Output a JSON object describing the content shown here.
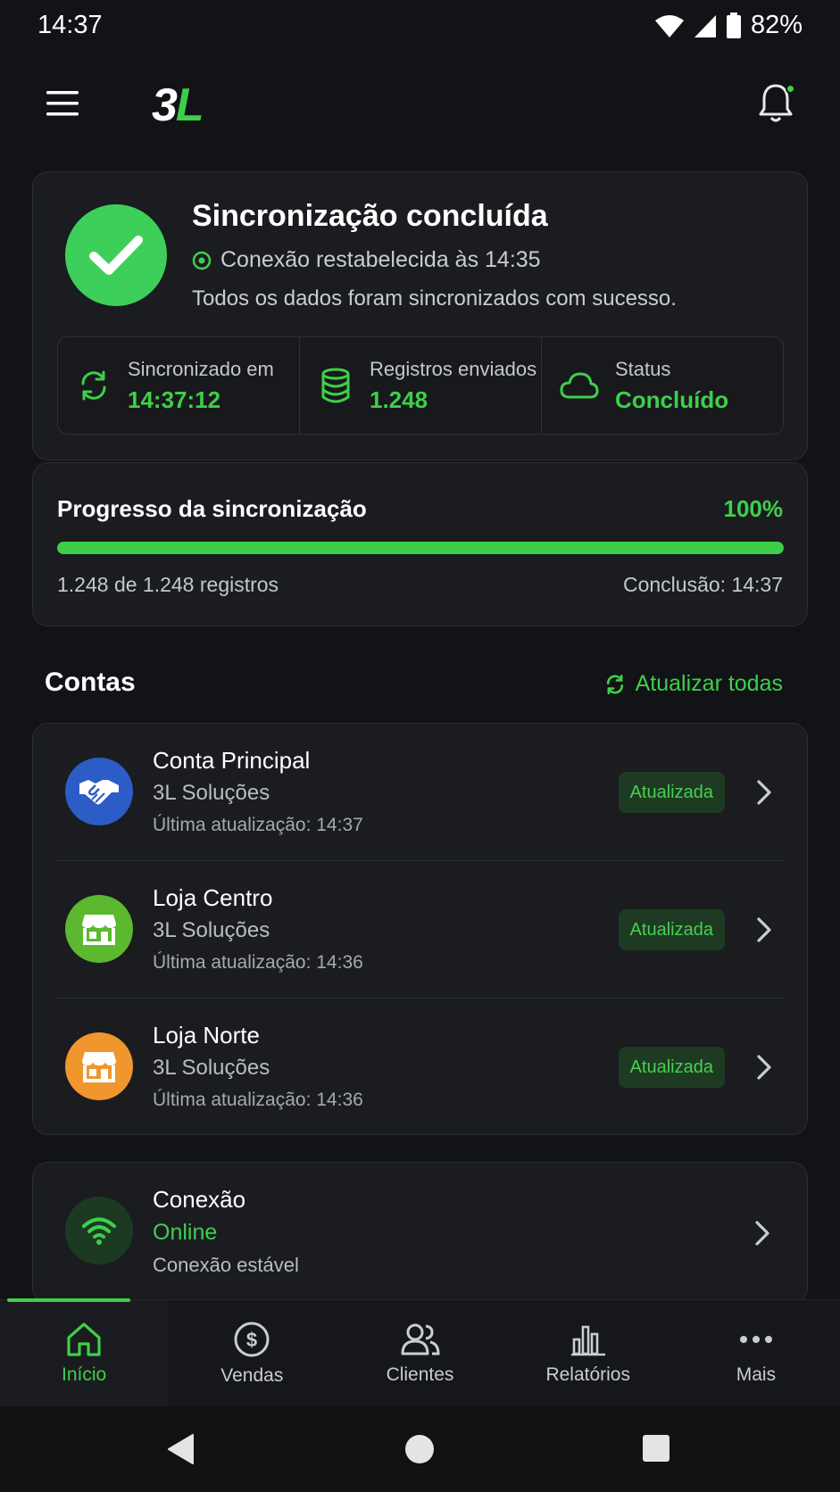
{
  "status_bar": {
    "time": "14:37",
    "battery": "82%"
  },
  "app_bar": {
    "logo_part1": "3",
    "logo_part2": "L",
    "notification_dot": true
  },
  "sync": {
    "title": "Sincronização concluída",
    "subtitle": "Conexão restabelecida às 14:35",
    "description": "Todos os dados foram sincronizados com sucesso.",
    "stats": [
      {
        "label": "Sincronizado em",
        "value": "14:37:12",
        "icon": "sync-icon"
      },
      {
        "label": "Registros enviados",
        "value": "1.248",
        "icon": "database-icon"
      },
      {
        "label": "Status",
        "value": "Concluído",
        "icon": "cloud-icon"
      }
    ]
  },
  "progress": {
    "title": "Progresso da sincronização",
    "percent_label": "100%",
    "percent": 100,
    "records": "1.248 de 1.248 registros",
    "completion": "Conclusão: 14:37"
  },
  "accounts": {
    "title": "Contas",
    "refresh_all": "Atualizar todas",
    "items": [
      {
        "name": "Conta Principal",
        "company": "3L Soluções",
        "updated": "Última atualização: 14:37",
        "badge": "Atualizada",
        "icon": "handshake-icon",
        "color": "#2c5cc5"
      },
      {
        "name": "Loja Centro",
        "company": "3L Soluções",
        "updated": "Última atualização: 14:36",
        "badge": "Atualizada",
        "icon": "store-icon",
        "color": "#5cb82e"
      },
      {
        "name": "Loja Norte",
        "company": "3L Soluções",
        "updated": "Última atualização: 14:36",
        "badge": "Atualizada",
        "icon": "store-icon",
        "color": "#f0962e"
      }
    ]
  },
  "connection": {
    "title": "Conexão",
    "status": "Online",
    "description": "Conexão estável"
  },
  "bottom_nav": [
    {
      "label": "Início",
      "icon": "home-icon",
      "active": true
    },
    {
      "label": "Vendas",
      "icon": "dollar-icon",
      "active": false
    },
    {
      "label": "Clientes",
      "icon": "users-icon",
      "active": false
    },
    {
      "label": "Relatórios",
      "icon": "bar-chart-icon",
      "active": false
    },
    {
      "label": "Mais",
      "icon": "more-icon",
      "active": false
    }
  ],
  "colors": {
    "accent": "#3ecf4a",
    "background": "#121316",
    "card": "#1a1c20"
  }
}
